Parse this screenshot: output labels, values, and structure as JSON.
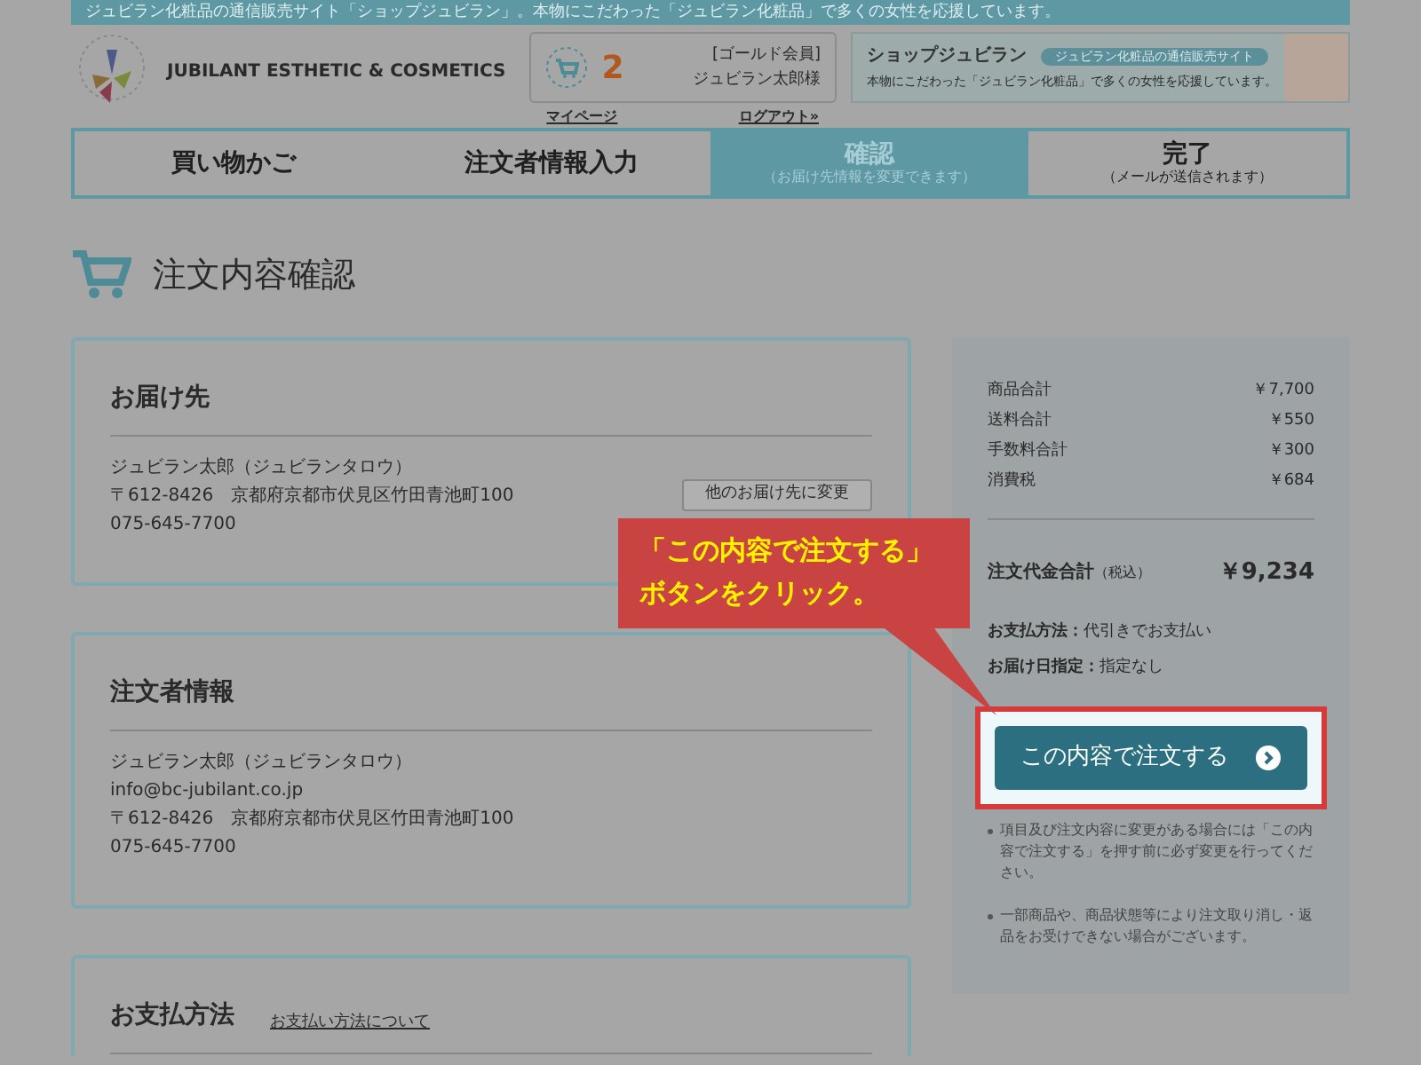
{
  "top_bar": {
    "text": "ジュビラン化粧品の通信販売サイト「ショップジュビラン」。本物にこだわった「ジュビラン化粧品」で多くの女性を応援しています。"
  },
  "header": {
    "brand": "JUBILANT ESTHETIC & COSMETICS",
    "cart_count": "2",
    "member_rank": "[ゴールド会員]",
    "member_name": "ジュビラン太郎様",
    "mypage_link": "マイページ",
    "logout_link": "ログアウト»",
    "banner": {
      "title": "ショップジュビラン",
      "tag": "ジュビラン化粧品の通信販売サイト",
      "text": "本物にこだわった「ジュビラン化粧品」で多くの女性を応援しています。"
    }
  },
  "steps": [
    {
      "label": "買い物かご",
      "selected": false
    },
    {
      "label": "注文者情報入力",
      "selected": false
    },
    {
      "label": "確認",
      "sub": "（お届け先情報を変更できます）",
      "selected": true
    },
    {
      "label": "完了",
      "sub": "（メールが送信されます）",
      "selected": false
    }
  ],
  "page_title": "注文内容確認",
  "sections": [
    {
      "heading": "お届け先",
      "lines": [
        "ジュビラン太郎（ジュビランタロウ）",
        "〒612-8426　京都府京都市伏見区竹田青池町100",
        "075-645-7700"
      ],
      "button": "他のお届け先に変更"
    },
    {
      "heading": "注文者情報",
      "lines": [
        "ジュビラン太郎（ジュビランタロウ）",
        "info@bc-jubilant.co.jp",
        "〒612-8426　京都府京都市伏見区竹田青池町100",
        "075-645-7700"
      ]
    },
    {
      "heading": "お支払方法",
      "link": "お支払い方法について"
    }
  ],
  "summary": {
    "rows": [
      {
        "label": "商品合計",
        "value": "￥7,700"
      },
      {
        "label": "送料合計",
        "value": "￥550"
      },
      {
        "label": "手数料合計",
        "value": "￥300"
      },
      {
        "label": "消費税",
        "value": "￥684"
      }
    ],
    "total_label": "注文代金合計",
    "total_note": "（税込）",
    "total_value": "￥9,234",
    "info": [
      {
        "label": "お支払方法：",
        "value": "代引きでお支払い"
      },
      {
        "label": "お届け日指定：",
        "value": "指定なし"
      }
    ],
    "order_button": "この内容で注文する",
    "notes": [
      "項目及び注文内容に変更がある場合には「この内容で注文する」を押す前に必ず変更を行ってください。",
      "一部商品や、商品状態等により注文取り消し・返品をお受けできない場合がございます。"
    ]
  },
  "callout": {
    "lines": [
      "「この内容で注文する」",
      "ボタンをクリック。"
    ]
  }
}
